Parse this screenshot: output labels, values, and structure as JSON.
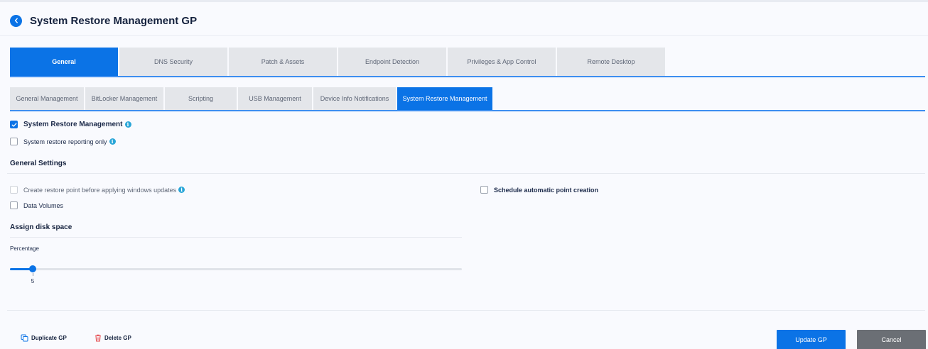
{
  "header": {
    "title": "System Restore Management GP",
    "back_icon": "chevron-left-icon"
  },
  "main_tabs": [
    {
      "label": "General",
      "active": true
    },
    {
      "label": "DNS Security",
      "active": false
    },
    {
      "label": "Patch & Assets",
      "active": false
    },
    {
      "label": "Endpoint Detection",
      "active": false
    },
    {
      "label": "Privileges & App Control",
      "active": false
    },
    {
      "label": "Remote Desktop",
      "active": false
    }
  ],
  "sub_tabs": [
    {
      "label": "General Management",
      "active": false
    },
    {
      "label": "BitLocker Management",
      "active": false
    },
    {
      "label": "Scripting",
      "active": false
    },
    {
      "label": "USB Management",
      "active": false
    },
    {
      "label": "Device Info Notifications",
      "active": false
    },
    {
      "label": "System Restore Management",
      "active": true
    }
  ],
  "options": {
    "system_restore_management": {
      "label": "System Restore Management",
      "checked": true
    },
    "reporting_only": {
      "label": "System restore reporting only",
      "checked": false
    }
  },
  "general_settings": {
    "title": "General Settings",
    "create_restore_point": {
      "label": "Create restore point before applying windows updates",
      "checked": false,
      "disabled": true
    },
    "data_volumes": {
      "label": "Data Volumes",
      "checked": false
    },
    "schedule_automatic": {
      "label": "Schedule automatic point creation",
      "checked": false
    }
  },
  "disk_space": {
    "title": "Assign disk space",
    "percentage_label": "Percentage",
    "value": 5,
    "min": 0,
    "max": 100
  },
  "footer": {
    "duplicate_label": "Duplicate GP",
    "delete_label": "Delete GP",
    "update_label": "Update GP",
    "cancel_label": "Cancel"
  },
  "colors": {
    "accent": "#0b73e6",
    "info": "#2aa6d8",
    "delete": "#e5484d",
    "cancel": "#6b6f75"
  }
}
